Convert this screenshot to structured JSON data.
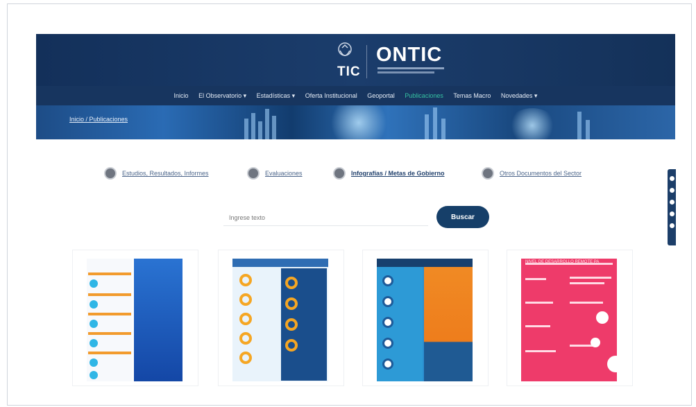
{
  "header": {
    "tic_label": "TIC",
    "brand_label": "ONTIC",
    "nav_items": [
      {
        "label": "Inicio",
        "active": false
      },
      {
        "label": "El Observatorio ▾",
        "active": false
      },
      {
        "label": "Estadísticas ▾",
        "active": false
      },
      {
        "label": "Oferta Institucional",
        "active": false
      },
      {
        "label": "Geoportal",
        "active": false
      },
      {
        "label": "Publicaciones",
        "active": true
      },
      {
        "label": "Temas Macro",
        "active": false
      },
      {
        "label": "Novedades ▾",
        "active": false
      }
    ],
    "breadcrumb": "Inicio / Publicaciones"
  },
  "tabs": [
    {
      "label": "Estudios, Resultados, Informes",
      "active": false
    },
    {
      "label": "Evaluaciones",
      "active": false
    },
    {
      "label": "Infografías / Metas de Gobierno",
      "active": true
    },
    {
      "label": "Otros Documentos del Sector",
      "active": false
    }
  ],
  "search": {
    "placeholder": "Ingrese texto",
    "button_label": "Buscar"
  },
  "cards": [
    {
      "theme": "blue-orange"
    },
    {
      "theme": "light-blue"
    },
    {
      "theme": "blue-orange-split"
    },
    {
      "theme": "pink",
      "heading": "NIVEL DE DESARROLLO REMOTE PA"
    }
  ],
  "colors": {
    "header_bg": "#17355f",
    "active_nav": "#36c3a2",
    "search_button": "#163f69"
  }
}
